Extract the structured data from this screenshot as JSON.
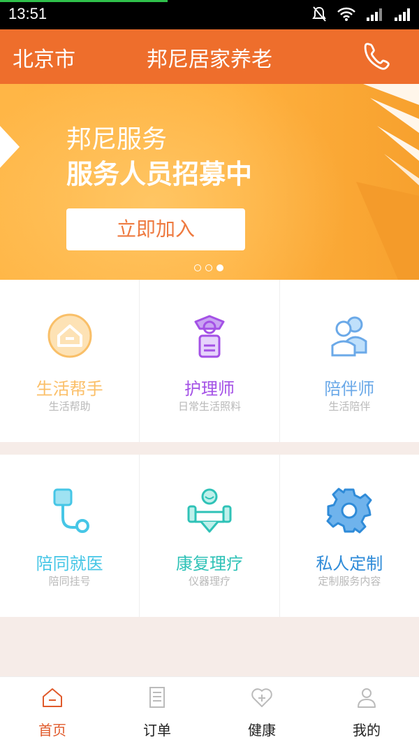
{
  "status": {
    "time": "13:51",
    "icons": [
      "mute-bell-icon",
      "wifi-icon",
      "signal-icon",
      "signal-icon-2"
    ]
  },
  "header": {
    "city": "北京市",
    "title": "邦尼居家养老",
    "phone_icon": "phone-icon"
  },
  "banner": {
    "line1": "邦尼服务",
    "line2": "服务人员招募中",
    "button": "立即加入",
    "slide_count": 3,
    "active_slide": 3
  },
  "services": [
    {
      "name": "生活帮手",
      "sub": "生活帮助",
      "icon": "house-icon",
      "color": "#fbbf68"
    },
    {
      "name": "护理师",
      "sub": "日常生活照料",
      "icon": "nurse-icon",
      "color": "#a451e6"
    },
    {
      "name": "陪伴师",
      "sub": "生活陪伴",
      "icon": "companion-icon",
      "color": "#6ba9e8"
    },
    {
      "name": "陪同就医",
      "sub": "陪同挂号",
      "icon": "stethoscope-icon",
      "color": "#46c6e6"
    },
    {
      "name": "康复理疗",
      "sub": "仪器理疗",
      "icon": "rehab-icon",
      "color": "#2fc2b7"
    },
    {
      "name": "私人定制",
      "sub": "定制服务内容",
      "icon": "gear-icon",
      "color": "#2f8bd8"
    }
  ],
  "tabs": [
    {
      "label": "首页",
      "icon": "home-icon",
      "active": true
    },
    {
      "label": "订单",
      "icon": "order-icon",
      "active": false
    },
    {
      "label": "健康",
      "icon": "health-heart-icon",
      "active": false
    },
    {
      "label": "我的",
      "icon": "profile-icon",
      "active": false
    }
  ],
  "colors": {
    "accent": "#ee6e2c",
    "tab_active": "#e05a2b"
  }
}
